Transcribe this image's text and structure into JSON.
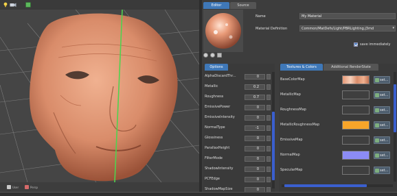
{
  "viewport": {
    "toolbar_icons": [
      "lightbulb-icon",
      "camera-icon",
      "color-swatch-icon"
    ],
    "status_items": [
      {
        "label": "User",
        "icon": "user-icon"
      },
      {
        "label": "Persp",
        "icon": "camera-view-icon"
      }
    ]
  },
  "editor": {
    "tabs": [
      {
        "label": "Editor"
      },
      {
        "label": "Source"
      }
    ],
    "name_label": "Name",
    "name_value": "My Material",
    "definition_label": "Material Definition",
    "definition_value": "Common/MatDefs/Light/PBRLighting.j3md",
    "save_label": "save immediately",
    "save_checked": true
  },
  "options": {
    "tab_label": "Options",
    "rows": [
      {
        "label": "AlphaDiscardThr...",
        "value": "0"
      },
      {
        "label": "Metallic",
        "value": "0.2"
      },
      {
        "label": "Roughness",
        "value": "0.7"
      },
      {
        "label": "EmissivePower",
        "value": "0"
      },
      {
        "label": "EmissiveIntensity",
        "value": "0"
      },
      {
        "label": "NormalType",
        "value": "-1"
      },
      {
        "label": "Glossiness",
        "value": "0"
      },
      {
        "label": "ParallaxHeight",
        "value": "0"
      },
      {
        "label": "FilterMode",
        "value": "0"
      },
      {
        "label": "ShadowIntensity",
        "value": "0"
      },
      {
        "label": "PCFEdge",
        "value": "0"
      },
      {
        "label": "ShadowMapSize",
        "value": "0"
      }
    ]
  },
  "textures": {
    "tabs": [
      {
        "label": "Textures & Colors"
      },
      {
        "label": "Additional RenderState"
      }
    ],
    "button_label": "set...",
    "rows": [
      {
        "label": "BaseColorMap",
        "swatch": "texture"
      },
      {
        "label": "MetallicMap",
        "swatch": "empty"
      },
      {
        "label": "RoughnessMap",
        "swatch": "empty"
      },
      {
        "label": "MetallicRoughnessMap",
        "swatch": "#f7a52a"
      },
      {
        "label": "EmissiveMap",
        "swatch": "empty"
      },
      {
        "label": "NormalMap",
        "swatch": "#8c8cf5"
      },
      {
        "label": "SpecularMap",
        "swatch": "empty"
      }
    ]
  },
  "colors": {
    "accent": "#3f78b8",
    "skin": "#d98c6a",
    "metallic_roughness_swatch": "#f7a52a",
    "normal_swatch": "#8c8cf5",
    "axis_line": "#4fd24f"
  }
}
